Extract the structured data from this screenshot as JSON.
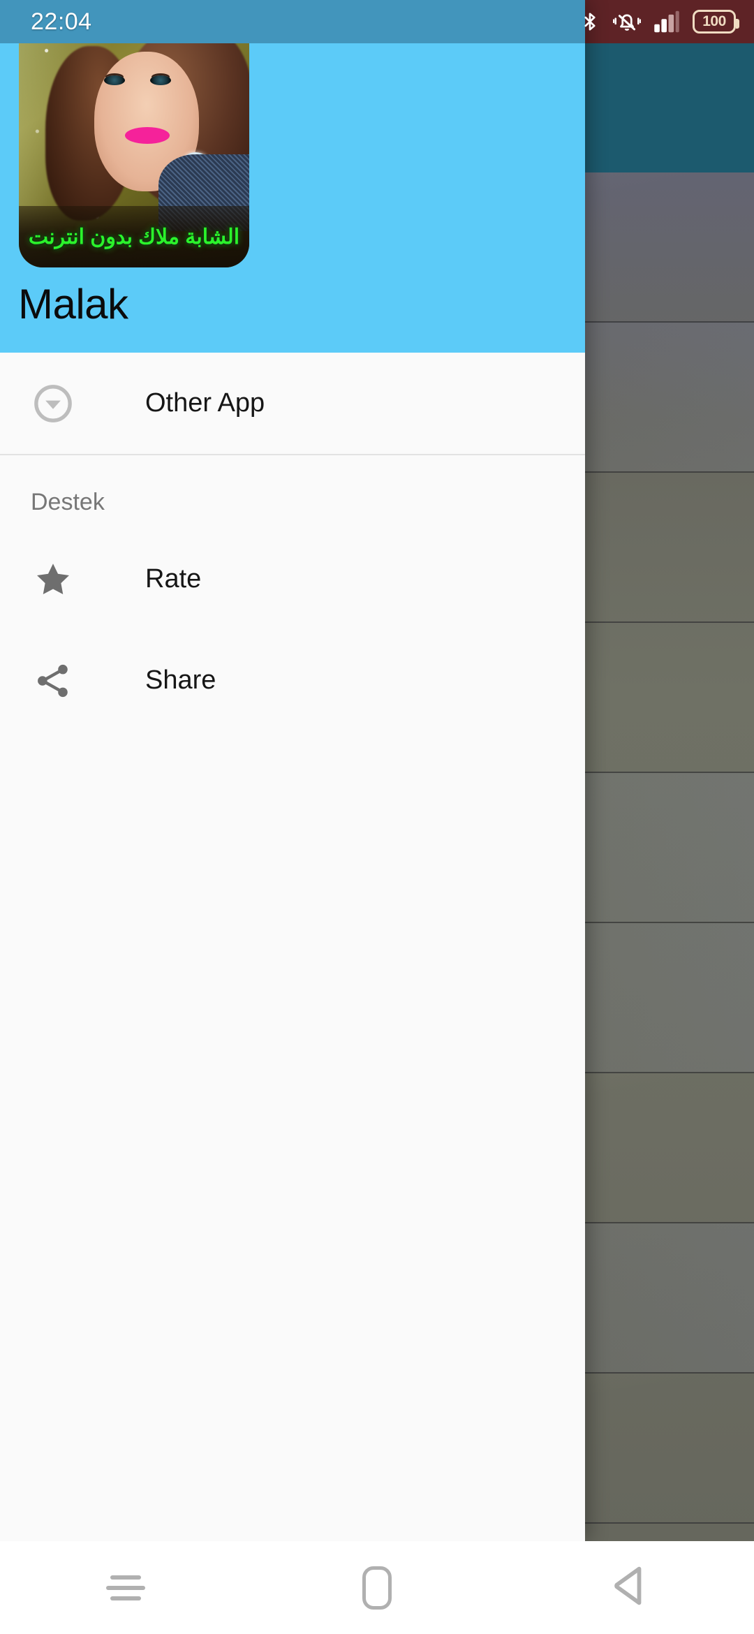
{
  "status_bar": {
    "clock": "22:04",
    "battery_level": "100",
    "icons": [
      "bluetooth-icon",
      "silent-vibrate-icon",
      "signal-bars-icon",
      "battery-icon"
    ],
    "left_tint_color": "#4295bc",
    "right_tint_color": "#5e2326"
  },
  "drawer": {
    "header": {
      "title": "Malak",
      "background_color": "#5ccbf8",
      "app_icon": {
        "name": "app-icon",
        "caption": "الشابة ملاك بدون انترنت",
        "caption_color": "#2bf32b"
      }
    },
    "items": [
      {
        "label": "Other App",
        "icon": "arrow-drop-down-circle-icon"
      }
    ],
    "sections": [
      {
        "title": "Destek",
        "items": [
          {
            "label": "Rate",
            "icon": "star-icon"
          },
          {
            "label": "Share",
            "icon": "share-icon"
          }
        ]
      }
    ]
  },
  "background_app": {
    "appbar_color": "#1c5a6e",
    "list_row_count": 9
  },
  "navigation_bar": {
    "buttons": [
      {
        "name": "recents-button",
        "icon": "menu-lines-icon"
      },
      {
        "name": "home-button",
        "icon": "home-rounded-square-icon"
      },
      {
        "name": "back-button",
        "icon": "back-triangle-icon"
      }
    ]
  }
}
